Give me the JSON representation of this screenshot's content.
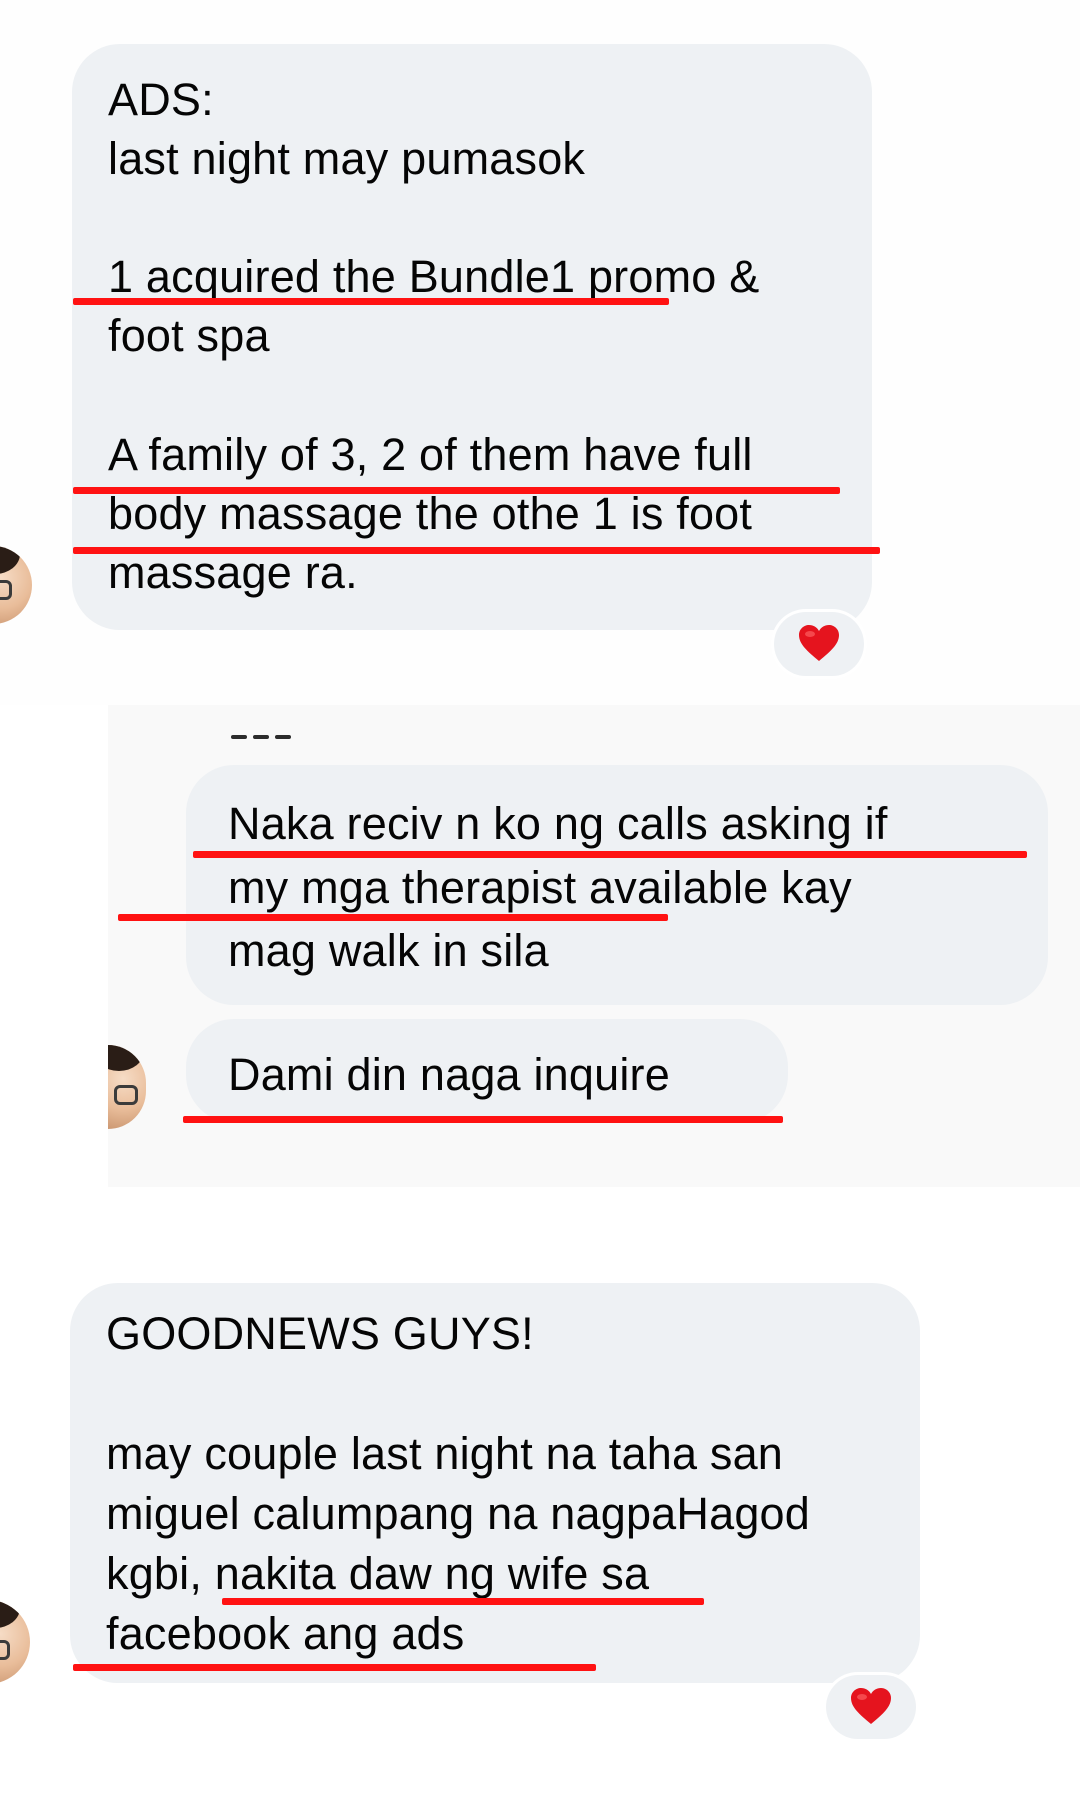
{
  "conversation": {
    "message1": {
      "lines": [
        "ADS:",
        " last night may pumasok",
        "",
        " 1 acquired the Bundle1 promo &",
        "foot spa",
        "",
        "A family of 3, 2 of them have full",
        "body massage the othe 1 is foot",
        "massage ra."
      ],
      "reaction": "heart-icon"
    },
    "message2": {
      "lines": [
        "Naka reciv n ko ng calls asking if",
        "my mga therapist available kay",
        "mag walk in sila"
      ]
    },
    "message3": {
      "lines": [
        "Dami din naga inquire"
      ]
    },
    "message4": {
      "lines": [
        "GOODNEWS GUYS!",
        "",
        "may couple last night na taha san",
        "miguel calumpang na nagpaHagod",
        "kgbi, nakita daw ng wife sa",
        "facebook ang ads"
      ],
      "reaction": "heart-icon"
    }
  },
  "colors": {
    "bubble": "#eef1f4",
    "underline": "#ff1212",
    "heart": "#e5141e"
  }
}
